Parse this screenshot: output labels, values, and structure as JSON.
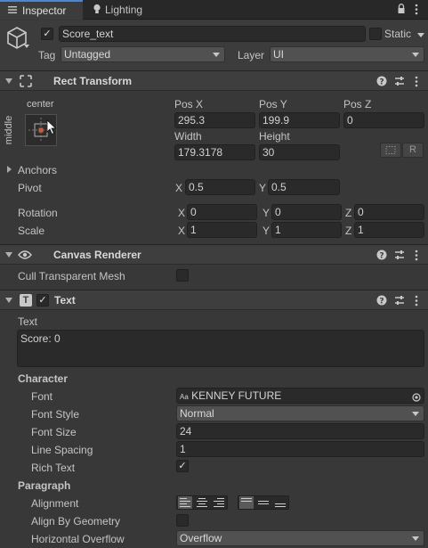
{
  "tabs": [
    {
      "label": "Inspector",
      "active": true
    },
    {
      "label": "Lighting",
      "active": false
    }
  ],
  "object": {
    "active": true,
    "name": "Score_text",
    "static_label": "Static",
    "tag_label": "Tag",
    "tag_value": "Untagged",
    "layer_label": "Layer",
    "layer_value": "UI"
  },
  "rect_transform": {
    "title": "Rect Transform",
    "anchor_h": "center",
    "anchor_v": "middle",
    "pos_x_label": "Pos X",
    "pos_x": "295.3",
    "pos_y_label": "Pos Y",
    "pos_y": "199.9",
    "pos_z_label": "Pos Z",
    "pos_z": "0",
    "width_label": "Width",
    "width": "179.3178",
    "height_label": "Height",
    "height": "30",
    "raw_button": "R",
    "anchors_label": "Anchors",
    "pivot_label": "Pivot",
    "pivot_x": "0.5",
    "pivot_y": "0.5",
    "rotation_label": "Rotation",
    "rot_x": "0",
    "rot_y": "0",
    "rot_z": "0",
    "scale_label": "Scale",
    "scale_x": "1",
    "scale_y": "1",
    "scale_z": "1",
    "axis_x": "X",
    "axis_y": "Y",
    "axis_z": "Z"
  },
  "canvas_renderer": {
    "title": "Canvas Renderer",
    "cull_label": "Cull Transparent Mesh",
    "cull": false
  },
  "text_component": {
    "title": "Text",
    "enabled": true,
    "text_label": "Text",
    "text_value": "Score: 0",
    "character_label": "Character",
    "font_label": "Font",
    "font_prefix": "Aa",
    "font_value": "KENNEY FUTURE",
    "font_style_label": "Font Style",
    "font_style_value": "Normal",
    "font_size_label": "Font Size",
    "font_size_value": "24",
    "line_spacing_label": "Line Spacing",
    "line_spacing_value": "1",
    "rich_text_label": "Rich Text",
    "rich_text": true,
    "paragraph_label": "Paragraph",
    "alignment_label": "Alignment",
    "align_by_geometry_label": "Align By Geometry",
    "align_by_geometry": false,
    "h_overflow_label": "Horizontal Overflow",
    "h_overflow_value": "Overflow"
  },
  "icons": [
    "lock-icon",
    "menu-icon",
    "cube-icon",
    "help-icon",
    "preset-icon",
    "kebab-icon",
    "eye-icon",
    "text-icon",
    "lightbulb-icon",
    "fold-arrow-icon",
    "object-picker-icon"
  ],
  "colors": {
    "panel": "#383838",
    "field": "#2a2a2a",
    "header": "#3e3e3e",
    "tab_active": "#3c3c3c",
    "tab_bar": "#282828"
  }
}
